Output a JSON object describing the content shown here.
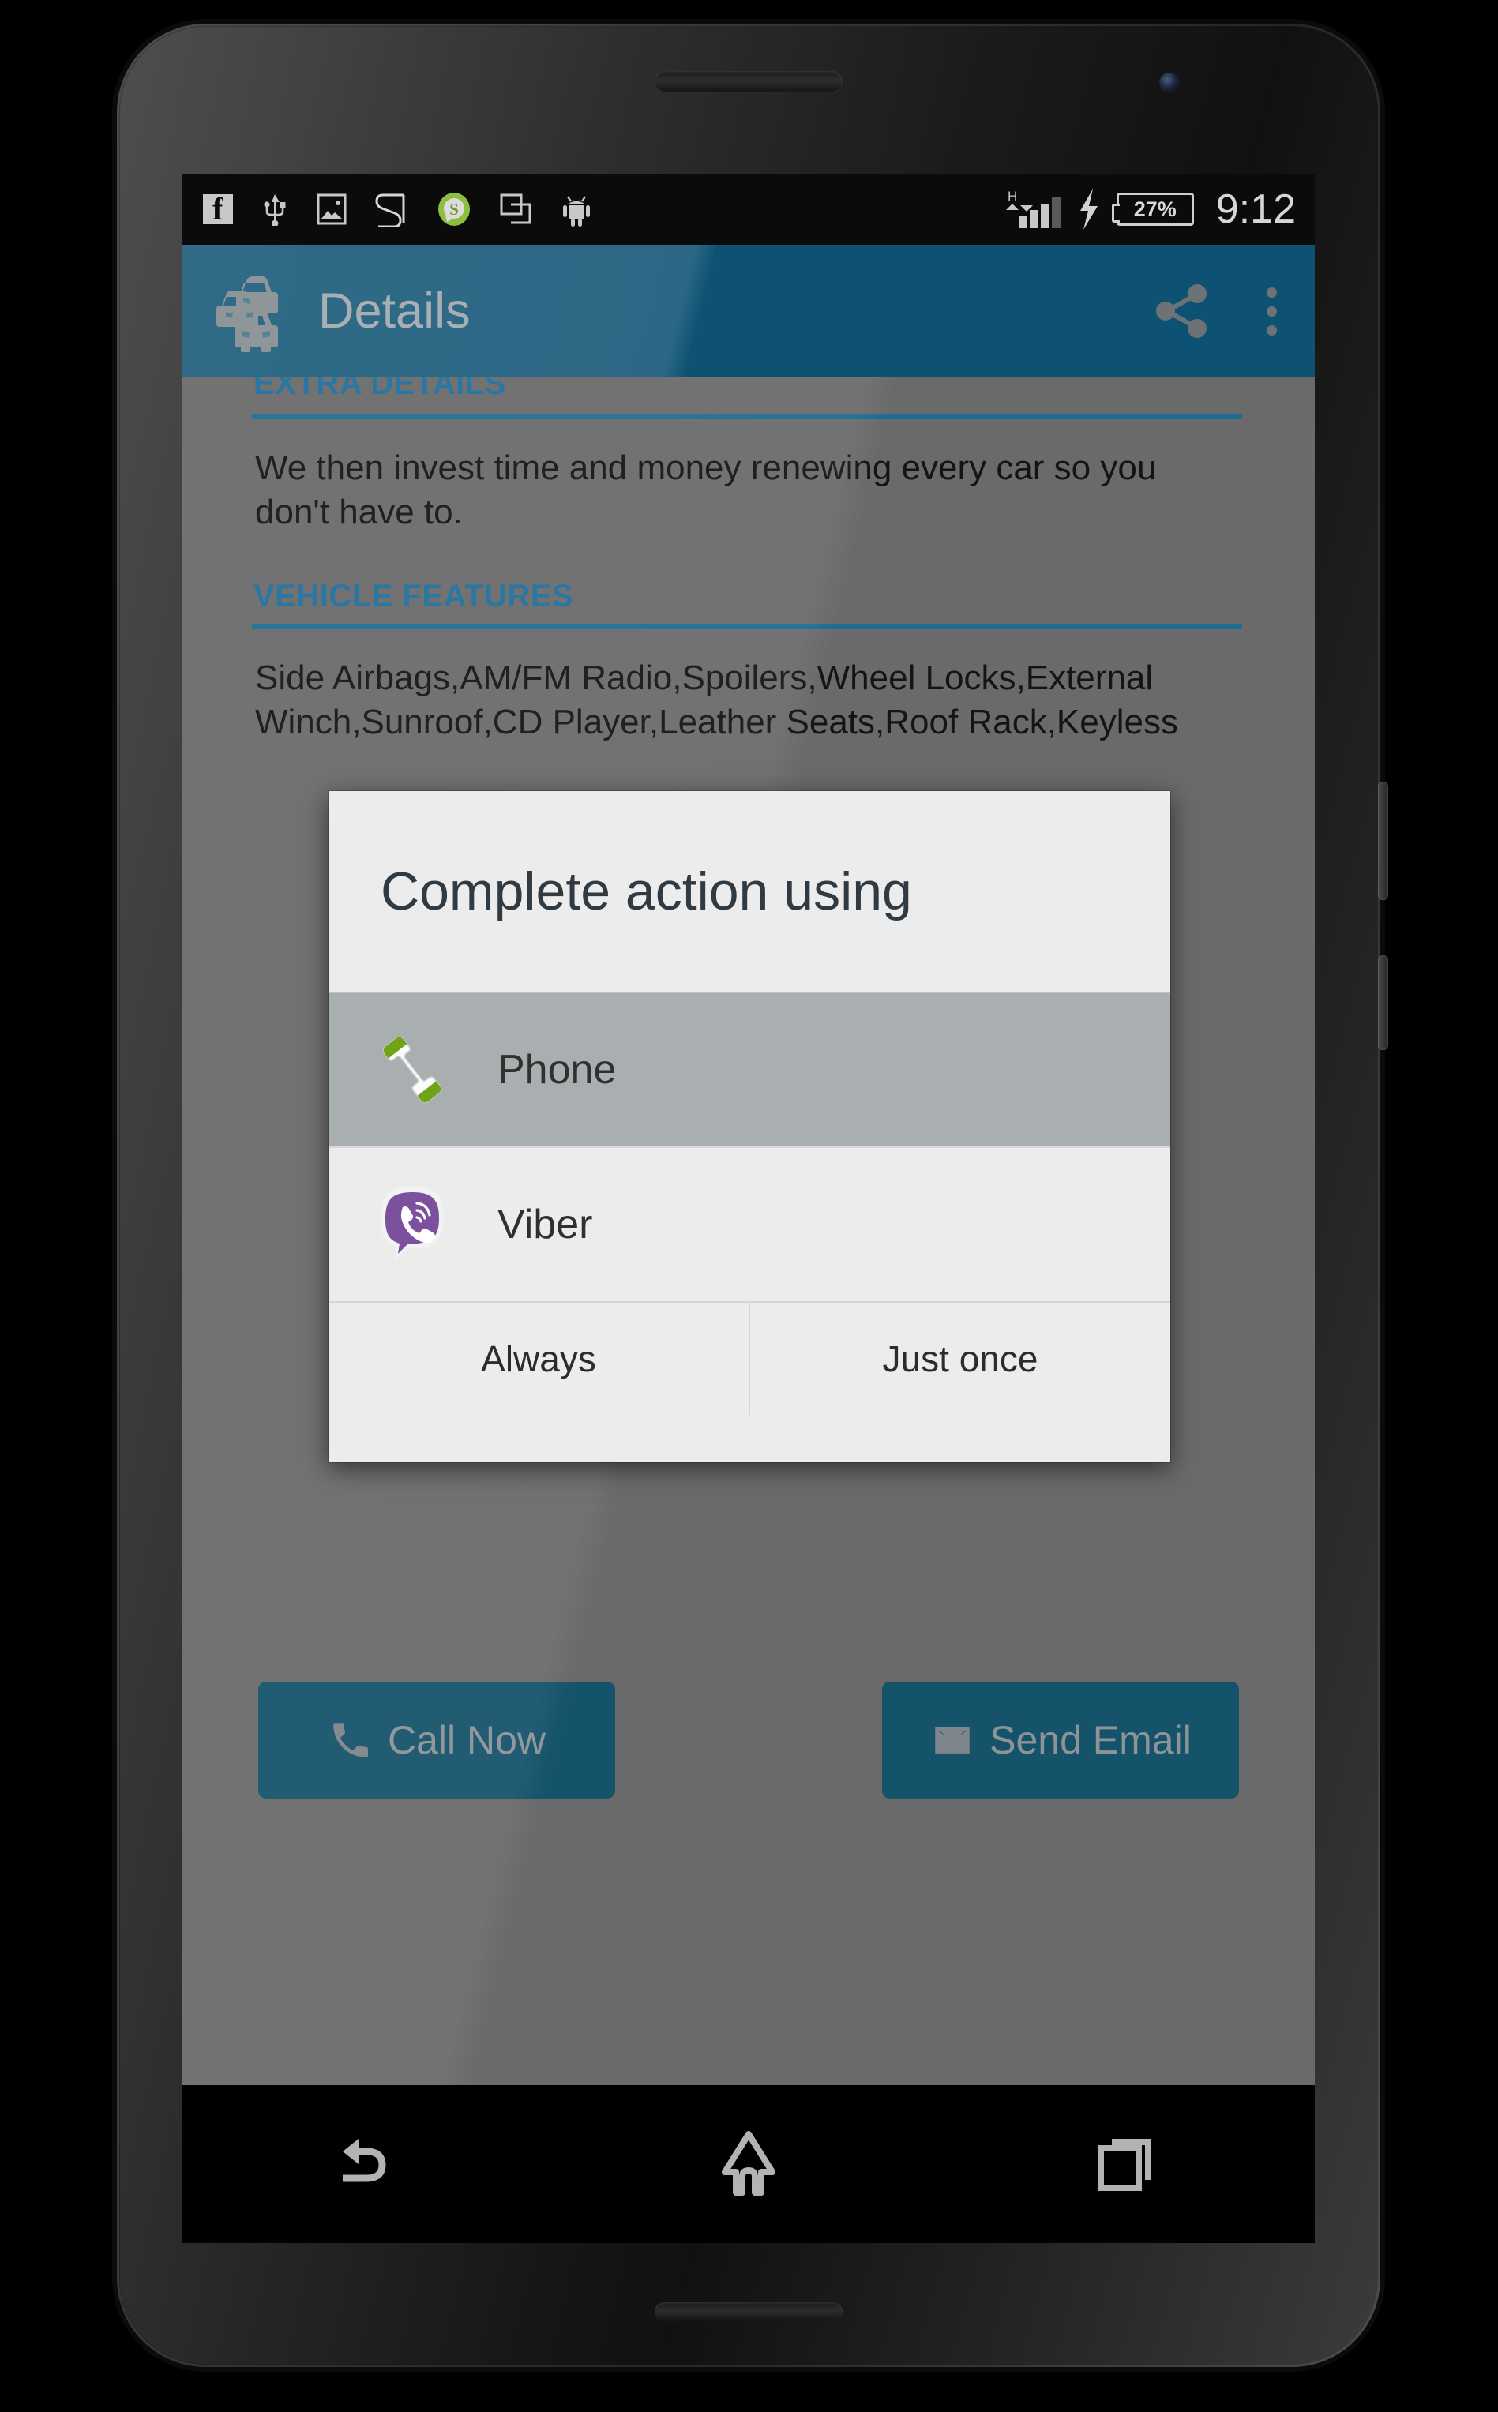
{
  "status_bar": {
    "icons": [
      "facebook-icon",
      "usb-icon",
      "photo-icon",
      "s-note-icon",
      "s-health-icon",
      "screenshot-icon",
      "android-icon"
    ],
    "network_type": "H",
    "battery_percent": "27%",
    "time": "9:12"
  },
  "action_bar": {
    "title": "Details",
    "logo": "cars-logo",
    "share_label": "share-icon",
    "overflow_label": "overflow-menu-icon",
    "background_color": "#0d5273"
  },
  "content": {
    "sections": [
      {
        "heading": "EXTRA DETAILS",
        "body": "We then invest time and money renewing every car so you don't have to."
      },
      {
        "heading": "VEHICLE FEATURES",
        "body": "Side Airbags,AM/FM Radio,Spoilers,Wheel Locks,External Winch,Sunroof,CD Player,Leather Seats,Roof Rack,Keyless"
      }
    ],
    "heading_color": "#1f6f9e",
    "buttons": [
      {
        "label": "Call Now",
        "icon": "phone-icon"
      },
      {
        "label": "Send Email",
        "icon": "envelope-icon"
      }
    ]
  },
  "dialog": {
    "title": "Complete action using",
    "apps": [
      {
        "label": "Phone",
        "icon": "phone-handset-icon",
        "selected": true
      },
      {
        "label": "Viber",
        "icon": "viber-icon",
        "selected": false
      }
    ],
    "buttons": [
      {
        "label": "Always"
      },
      {
        "label": "Just once"
      }
    ]
  },
  "nav_bar": {
    "buttons": [
      "back-icon",
      "home-icon",
      "recents-icon"
    ]
  }
}
